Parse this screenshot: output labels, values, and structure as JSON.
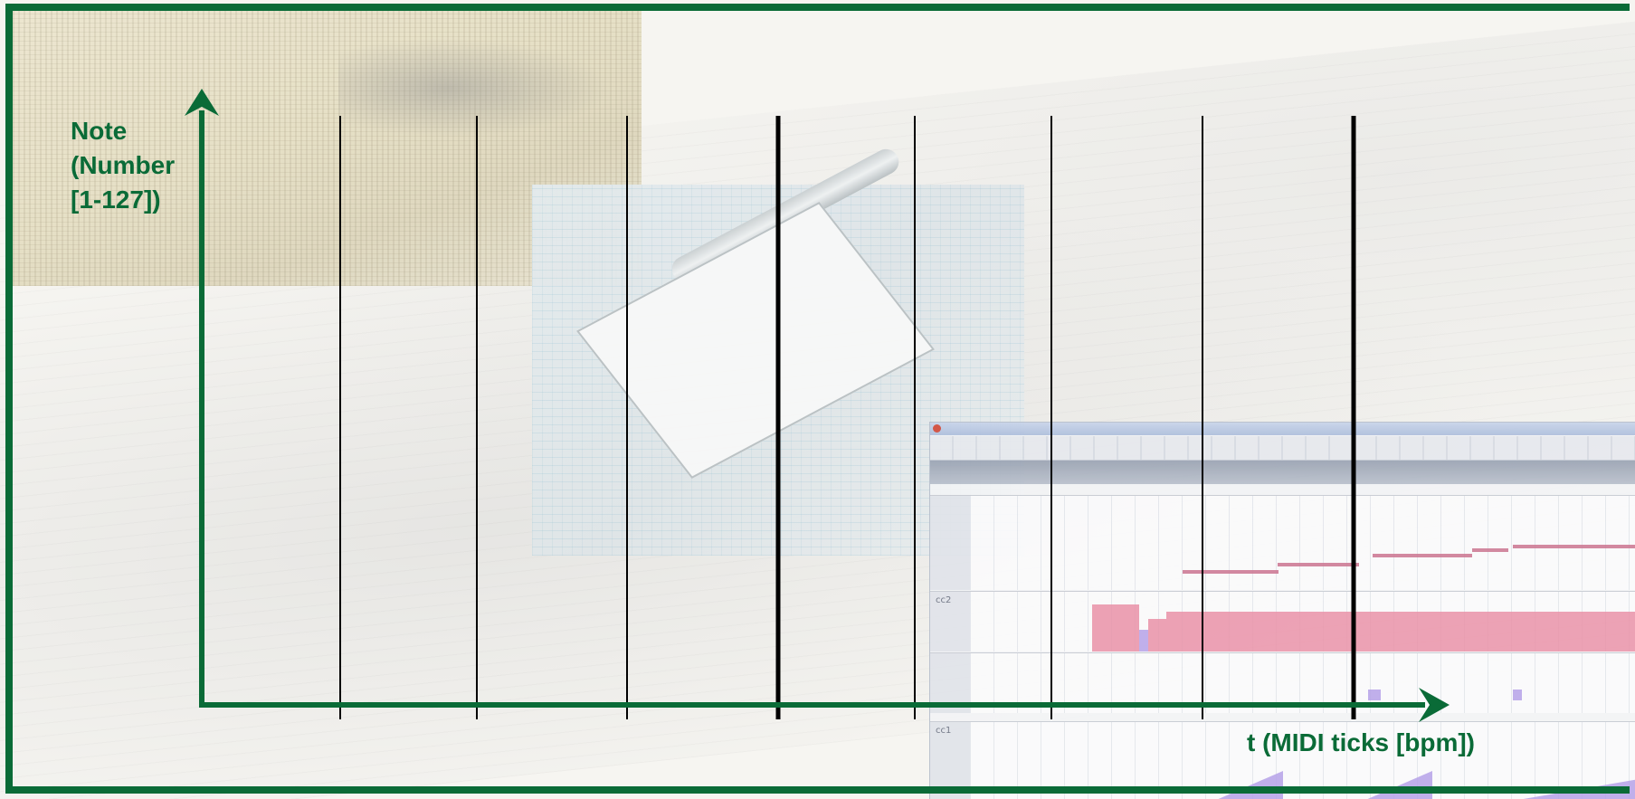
{
  "diagram": {
    "y_axis_label_lines": [
      "Note",
      "(Number",
      "[1-127])"
    ],
    "x_axis_label": "t (MIDI ticks [bpm])",
    "colors": {
      "axis": "#0a6b37",
      "frame": "#0a6b37",
      "grid_line": "#000000"
    }
  },
  "editor": {
    "lanes": {
      "cc2_label": "cc2",
      "cc1_label": "cc1"
    }
  }
}
